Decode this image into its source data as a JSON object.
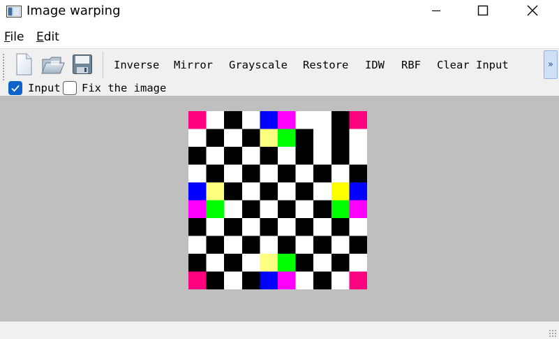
{
  "window": {
    "title": "Image warping",
    "app_icon": "window-app-icon",
    "controls": [
      "minimize-icon",
      "maximize-icon",
      "close-icon"
    ]
  },
  "menu": {
    "file": {
      "mnemonic": "F",
      "rest": "ile"
    },
    "edit": {
      "mnemonic": "E",
      "rest": "dit"
    }
  },
  "toolbar": {
    "icons": [
      "new-file-icon",
      "open-folder-icon",
      "save-icon"
    ],
    "actions": [
      "Inverse",
      "Mirror",
      "Grayscale",
      "Restore",
      "IDW",
      "RBF",
      "Clear Input"
    ],
    "overflow_label": "»",
    "checkboxes": [
      {
        "label": "Input",
        "checked": true
      },
      {
        "label": "Fix the image",
        "checked": false
      }
    ]
  },
  "image": {
    "description_colors": {
      "black": "#000000",
      "white": "#ffffff",
      "pink": "#ff0080",
      "blue": "#0000ff",
      "magenta": "#ff00ff",
      "lightyellow": "#ffff80",
      "yellow": "#ffff00",
      "green": "#00ff00"
    },
    "grid": [
      [
        "pink",
        "white",
        "black",
        "white",
        "blue",
        "magenta",
        "white",
        "white",
        "black",
        "pink"
      ],
      [
        "white",
        "black",
        "white",
        "black",
        "lightyellow",
        "green",
        "black",
        "white",
        "black",
        "white"
      ],
      [
        "black",
        "white",
        "black",
        "white",
        "black",
        "white",
        "black",
        "white",
        "black",
        "white"
      ],
      [
        "white",
        "black",
        "white",
        "black",
        "white",
        "black",
        "white",
        "black",
        "white",
        "black"
      ],
      [
        "blue",
        "lightyellow",
        "black",
        "white",
        "black",
        "white",
        "black",
        "white",
        "yellow",
        "blue"
      ],
      [
        "magenta",
        "green",
        "white",
        "black",
        "white",
        "black",
        "white",
        "black",
        "green",
        "magenta"
      ],
      [
        "black",
        "white",
        "black",
        "white",
        "black",
        "white",
        "black",
        "white",
        "black",
        "white"
      ],
      [
        "white",
        "black",
        "white",
        "black",
        "white",
        "black",
        "white",
        "black",
        "white",
        "black"
      ],
      [
        "black",
        "white",
        "black",
        "white",
        "lightyellow",
        "green",
        "black",
        "white",
        "black",
        "white"
      ],
      [
        "pink",
        "black",
        "white",
        "black",
        "blue",
        "magenta",
        "white",
        "black",
        "white",
        "pink"
      ]
    ]
  }
}
